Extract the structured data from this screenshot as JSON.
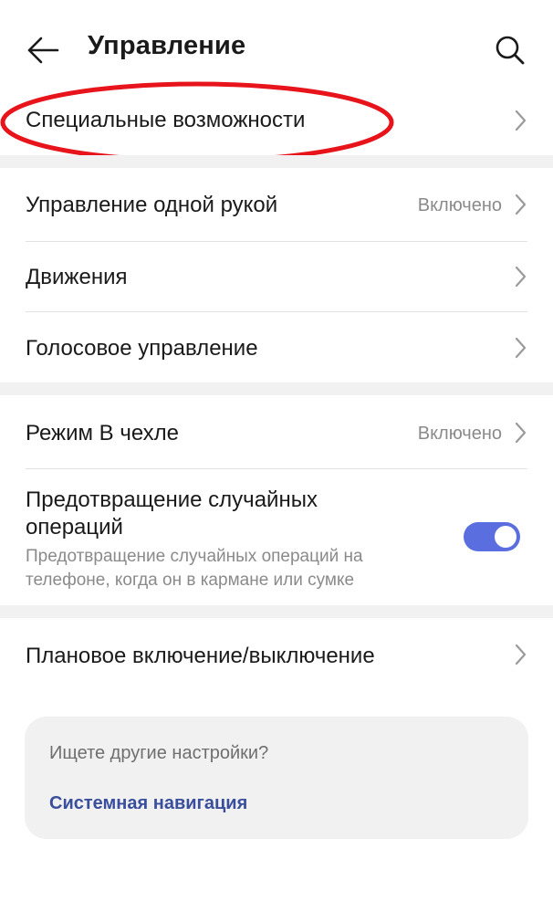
{
  "header": {
    "title": "Управление"
  },
  "sections": [
    {
      "items": [
        {
          "label": "Специальные возможности",
          "value": ""
        }
      ]
    },
    {
      "items": [
        {
          "label": "Управление одной рукой",
          "value": "Включено"
        },
        {
          "label": "Движения",
          "value": ""
        },
        {
          "label": "Голосовое управление",
          "value": ""
        }
      ]
    },
    {
      "items": [
        {
          "label": "Режим В чехле",
          "value": "Включено"
        }
      ],
      "toggle_item": {
        "title": "Предотвращение случайных операций",
        "description": "Предотвращение случайных операций на телефоне, когда он в кармане или сумке",
        "enabled": true
      }
    },
    {
      "items": [
        {
          "label": "Плановое включение/выключение",
          "value": ""
        }
      ]
    }
  ],
  "suggestions": {
    "title": "Ищете другие настройки?",
    "link": "Системная навигация"
  },
  "icons": {
    "back": "arrow-left-icon",
    "search": "search-icon",
    "chevron": "chevron-right-icon"
  },
  "colors": {
    "toggle_on": "#5b6ee0",
    "highlight": "#e8141c",
    "link": "#3a4f9c",
    "secondary_text": "#8a8a8a",
    "section_gap": "#f1f1f1"
  }
}
